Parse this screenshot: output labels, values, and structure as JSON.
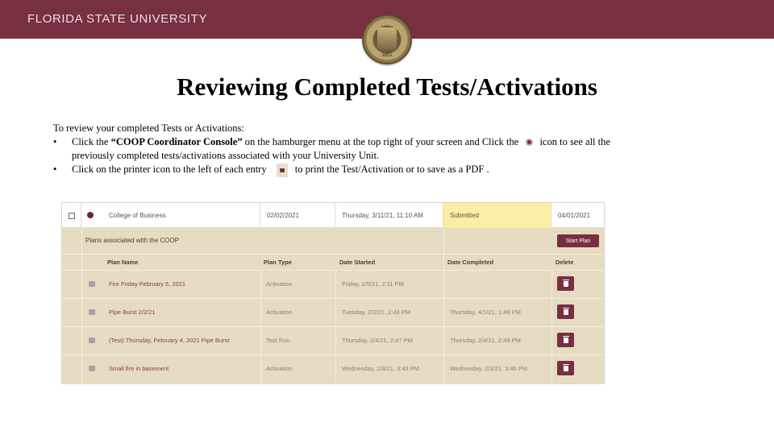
{
  "header": {
    "university": "FLORIDA STATE UNIVERSITY",
    "seal_year": "1851",
    "brand_color": "#782f40"
  },
  "title": "Reviewing Completed Tests/Activations",
  "instructions": {
    "intro": "To review your completed Tests or Activations:",
    "bullet1_pre": "Click the ",
    "bullet1_bold": "“COOP Coordinator Console”",
    "bullet1_mid": " on the hamburger menu at the top right of your screen  and Click the ",
    "bullet1_post": "icon to see all the",
    "bullet1_line2": "previously completed tests/activations associated with your University Unit.",
    "bullet2_pre": "Click on the printer icon to the left of each entry ",
    "bullet2_post": "to print the Test/Activation or to save as a PDF ."
  },
  "screenshot": {
    "top_row": {
      "unit": "College of Business",
      "date1": "02/02/2021",
      "date2": "Thursday, 3/11/21, 11:10 AM",
      "status": "Submitted",
      "date3": "04/01/2021"
    },
    "panel_label": "Plans associated with the COOP",
    "start_plan_label": "Start Plan",
    "columns": [
      "Plan Name",
      "Plan Type",
      "Date Started",
      "Date Completed",
      "Delete"
    ],
    "rows": [
      {
        "name": "Fire Friday February 5, 2021",
        "type": "Activation",
        "started": "Friday, 2/5/21, 2:11 PM",
        "completed": ""
      },
      {
        "name": "Pipe Burst 2/2/21",
        "type": "Activation",
        "started": "Tuesday, 2/2/21, 2:43 PM",
        "completed": "Thursday, 4/1/21, 1:48 PM"
      },
      {
        "name": "(Test) Thursday, February 4, 2021 Pipe Burst",
        "type": "Test Run",
        "started": "Thursday, 2/4/21, 2:47 PM",
        "completed": "Thursday, 2/4/21, 2:49 PM"
      },
      {
        "name": "Small fire in basement",
        "type": "Activation",
        "started": "Wednesday, 2/3/21, 3:43 PM",
        "completed": "Wednesday, 2/3/21, 3:46 PM"
      }
    ]
  }
}
